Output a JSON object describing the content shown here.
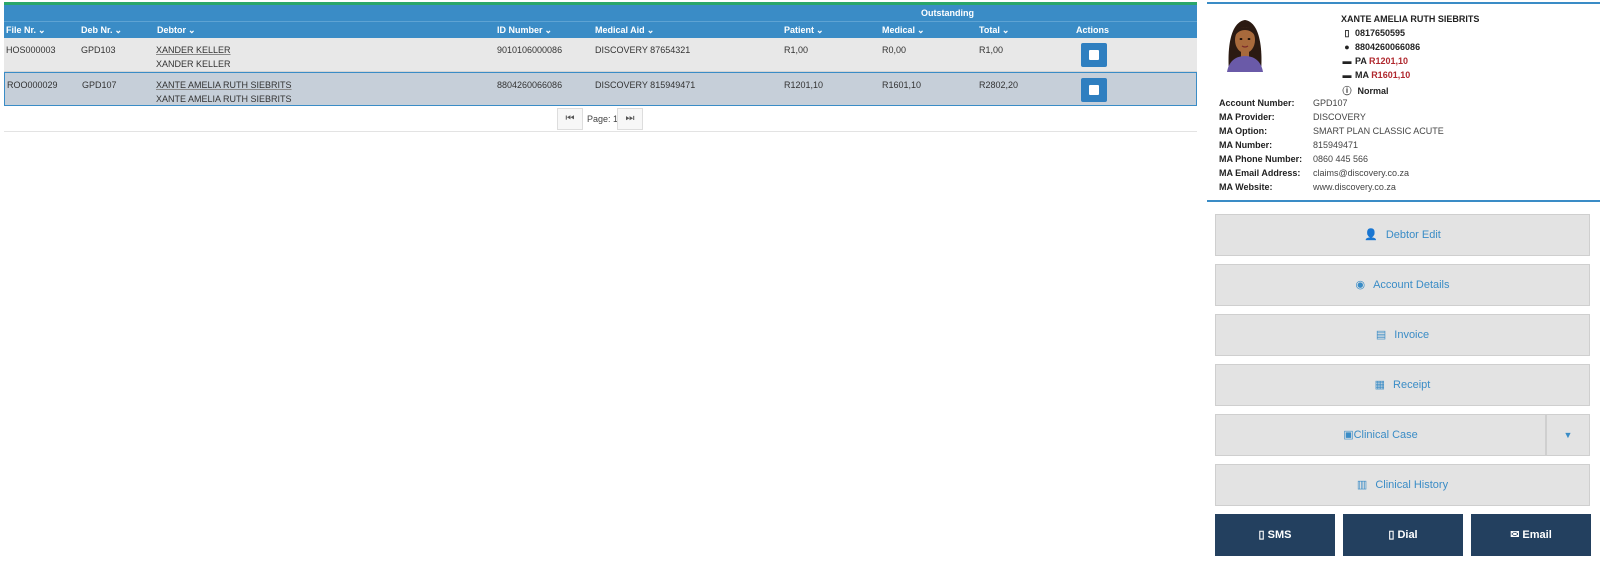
{
  "grid": {
    "group_header": "Outstanding",
    "columns": {
      "file_nr": "File Nr.",
      "deb_nr": "Deb Nr.",
      "debtor": "Debtor",
      "id_number": "ID Number",
      "medical_aid": "Medical Aid",
      "patient": "Patient",
      "medical": "Medical",
      "total": "Total",
      "actions": "Actions"
    },
    "rows": [
      {
        "file_nr": "HOS000003",
        "deb_nr": "GPD103",
        "debtor": "XANDER KELLER",
        "debtor_sub": "XANDER KELLER",
        "id_number": "9010106000086",
        "medical_aid": "DISCOVERY 87654321",
        "patient": "R1,00",
        "medical": "R0,00",
        "total": "R1,00"
      },
      {
        "file_nr": "ROO000029",
        "deb_nr": "GPD107",
        "debtor": "XANTE AMELIA RUTH SIEBRITS",
        "debtor_sub": "XANTE AMELIA RUTH SIEBRITS",
        "id_number": "8804260066086",
        "medical_aid": "DISCOVERY 815949471",
        "patient": "R1201,10",
        "medical": "R1601,10",
        "total": "R2802,20"
      }
    ],
    "pager": {
      "label": "Page: 1"
    }
  },
  "panel": {
    "name": "XANTE AMELIA RUTH SIEBRITS",
    "phone": "0817650595",
    "id_number": "8804260066086",
    "pa_label": "PA",
    "pa_amount": "R1201,10",
    "ma_label": "MA",
    "ma_amount": "R1601,10",
    "status": "Normal",
    "details": [
      {
        "label": "Account Number:",
        "value": "GPD107"
      },
      {
        "label": "MA Provider:",
        "value": "DISCOVERY"
      },
      {
        "label": "MA Option:",
        "value": "SMART PLAN CLASSIC ACUTE"
      },
      {
        "label": "MA Number:",
        "value": "815949471"
      },
      {
        "label": "MA Phone Number:",
        "value": "0860 445 566"
      },
      {
        "label": "MA Email Address:",
        "value": "claims@discovery.co.za"
      },
      {
        "label": "MA Website:",
        "value": "www.discovery.co.za"
      }
    ],
    "buttons": {
      "debtor_edit": "Debtor Edit",
      "account_details": "Account Details",
      "invoice": "Invoice",
      "receipt": "Receipt",
      "clinical_case": "Clinical Case",
      "clinical_history": "Clinical History",
      "sms": "SMS",
      "dial": "Dial",
      "email": "Email"
    }
  },
  "colors": {
    "header_blue": "#3a8cc6",
    "accent_green": "#2aa66a",
    "dark_navy": "#23405f",
    "amount_red": "#b0282e"
  },
  "icons": {
    "sort": "chevron-down-icon",
    "row_action": "note-icon",
    "first_page": "first-page-icon",
    "last_page": "last-page-icon",
    "phone": "mobile-phone-icon",
    "id": "user-icon",
    "card": "credit-card-icon",
    "status": "info-icon"
  }
}
